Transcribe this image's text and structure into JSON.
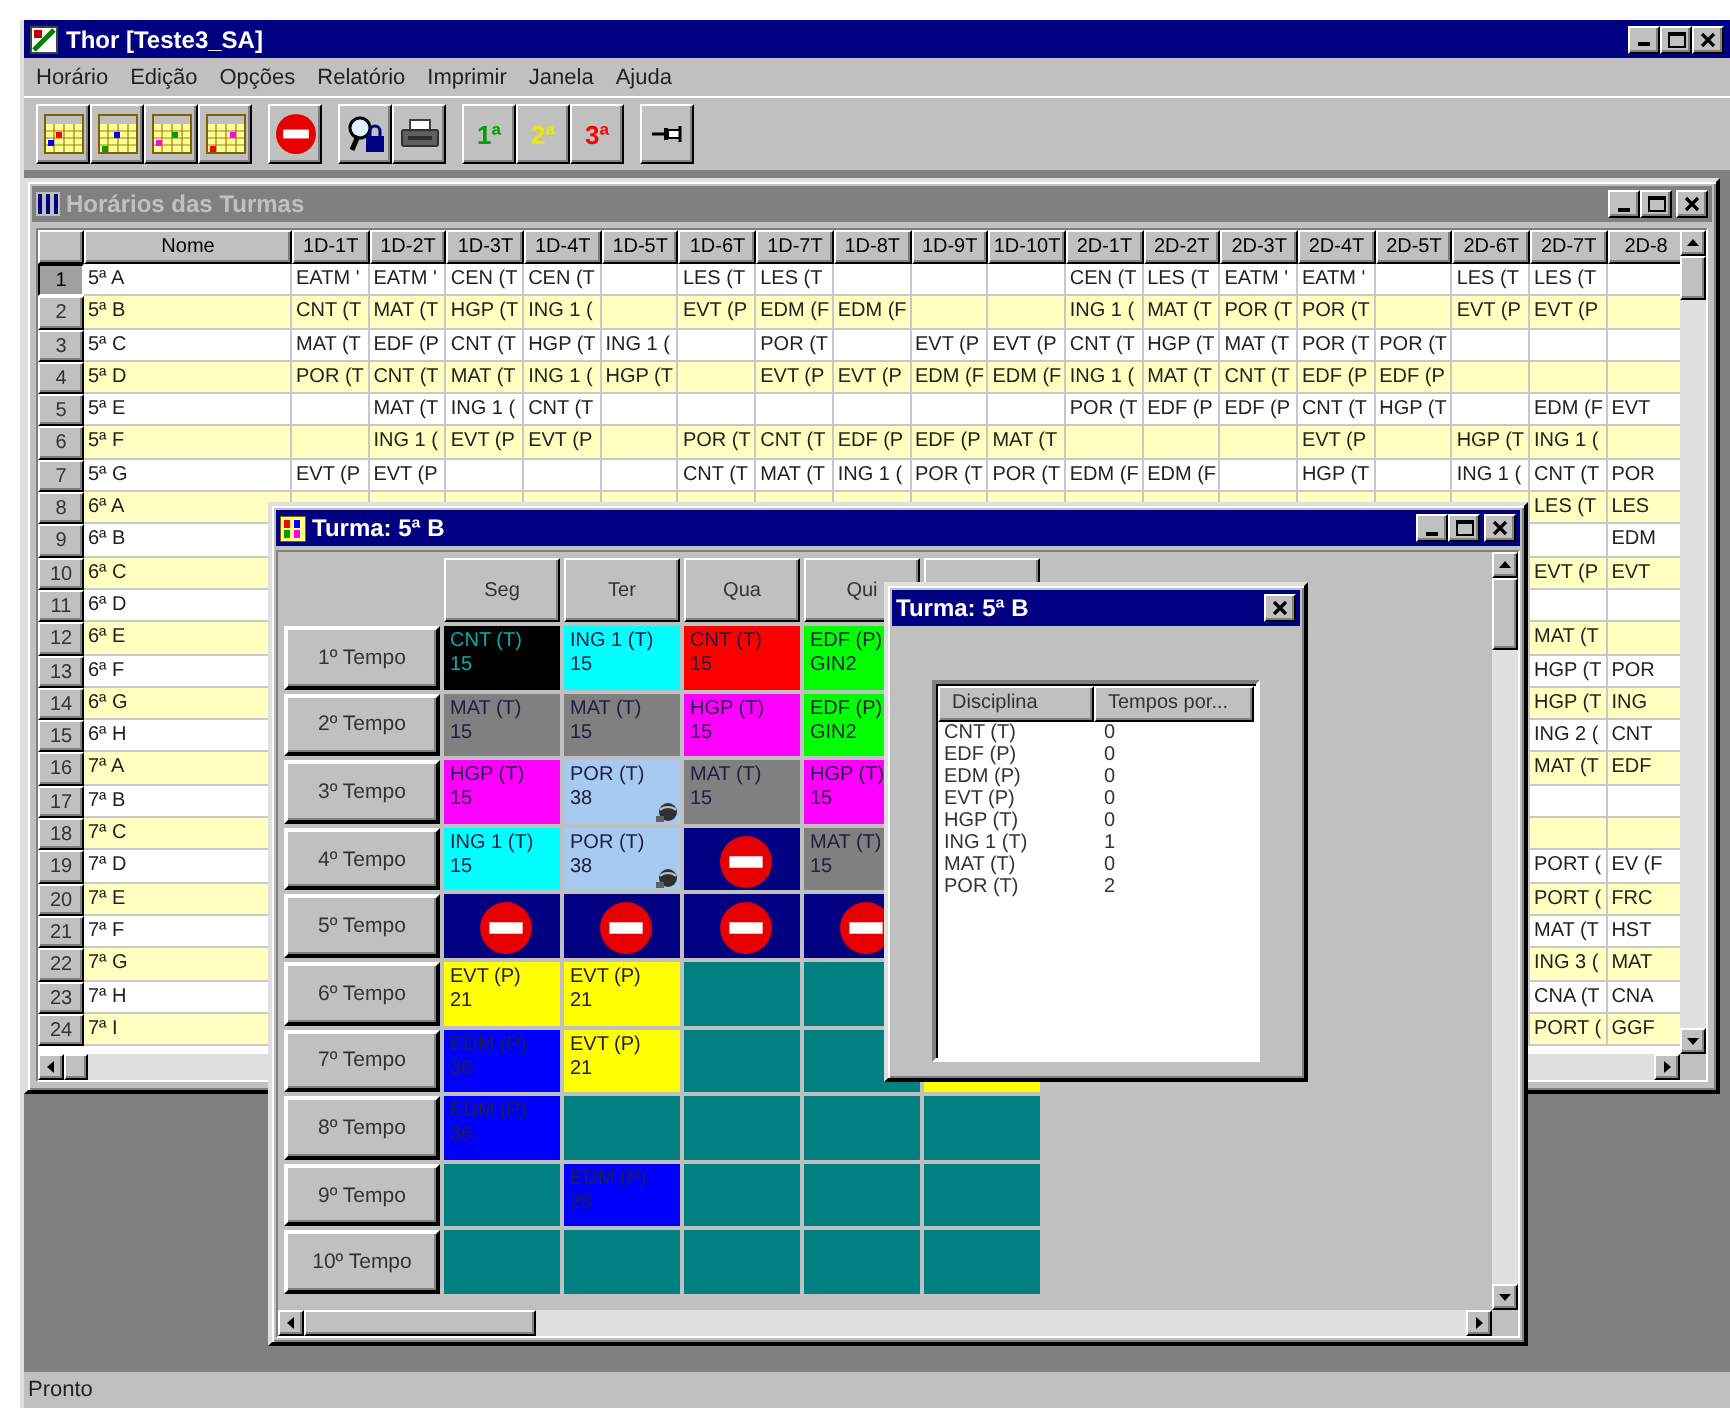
{
  "window": {
    "title": "Thor [Teste3_SA]"
  },
  "menu": [
    "Horário",
    "Edição",
    "Opções",
    "Relatório",
    "Imprimir",
    "Janela",
    "Ajuda"
  ],
  "toolbar": [
    [
      {
        "kind": "calendar"
      },
      {
        "kind": "calendar"
      },
      {
        "kind": "calendar"
      },
      {
        "kind": "calendar"
      }
    ],
    [
      {
        "kind": "stop"
      }
    ],
    [
      {
        "kind": "lock"
      },
      {
        "kind": "printer"
      }
    ],
    [
      {
        "kind": "label",
        "label": "1ª",
        "color": "#00a000"
      },
      {
        "kind": "label",
        "label": "2ª",
        "color": "#e8e800"
      },
      {
        "kind": "label",
        "label": "3ª",
        "color": "#ff0000"
      }
    ],
    [
      {
        "kind": "pin"
      }
    ]
  ],
  "schedule_window": {
    "title": "Horários das Turmas",
    "active": false,
    "columns": [
      "Nome",
      "1D-1T",
      "1D-2T",
      "1D-3T",
      "1D-4T",
      "1D-5T",
      "1D-6T",
      "1D-7T",
      "1D-8T",
      "1D-9T",
      "1D-10T",
      "2D-1T",
      "2D-2T",
      "2D-3T",
      "2D-4T",
      "2D-5T",
      "2D-6T",
      "2D-7T",
      "2D-8"
    ],
    "rows": [
      {
        "cells": [
          "5ª A",
          "EATM '",
          "EATM '",
          "CEN (T",
          "CEN (T",
          "",
          "LES (T",
          "LES (T",
          "",
          "",
          "",
          "CEN (T",
          "LES (T",
          "EATM '",
          "EATM '",
          "",
          "LES (T",
          "LES (T",
          ""
        ],
        "number": "1",
        "selected": true
      },
      {
        "cells": [
          "5ª B",
          "CNT (T",
          "MAT (T",
          "HGP (T",
          "ING 1 (",
          "",
          "EVT (P",
          "EDM (F",
          "EDM (F",
          "",
          "",
          "ING 1 (",
          "MAT (T",
          "POR (T",
          "POR (T",
          "",
          "EVT (P",
          "EVT (P",
          ""
        ],
        "number": "2",
        "selected": false
      },
      {
        "cells": [
          "5ª C",
          "MAT (T",
          "EDF (P",
          "CNT (T",
          "HGP (T",
          "ING 1 (",
          "",
          "POR (T",
          "",
          "EVT (P",
          "EVT (P",
          "CNT (T",
          "HGP (T",
          "MAT (T",
          "POR (T",
          "POR (T",
          "",
          "",
          ""
        ],
        "number": "3",
        "selected": false
      },
      {
        "cells": [
          "5ª D",
          "POR (T",
          "CNT (T",
          "MAT (T",
          "ING 1 (",
          "HGP (T",
          "",
          "EVT (P",
          "EVT (P",
          "EDM (F",
          "EDM (F",
          "ING 1 (",
          "MAT (T",
          "CNT (T",
          "EDF (P",
          "EDF (P",
          "",
          "",
          ""
        ],
        "number": "4",
        "selected": false
      },
      {
        "cells": [
          "5ª E",
          "",
          "MAT (T",
          "ING 1 (",
          "CNT (T",
          "",
          "",
          "",
          "",
          "",
          "",
          "POR (T",
          "EDF (P",
          "EDF (P",
          "CNT (T",
          "HGP (T",
          "",
          "EDM (F",
          "EVT"
        ],
        "number": "5",
        "selected": false
      },
      {
        "cells": [
          "5ª F",
          "",
          "ING 1 (",
          "EVT (P",
          "EVT (P",
          "",
          "POR (T",
          "CNT (T",
          "EDF (P",
          "EDF (P",
          "MAT (T",
          "",
          "",
          "",
          "EVT (P",
          "",
          "HGP (T",
          "ING 1 (",
          ""
        ],
        "number": "6",
        "selected": false
      },
      {
        "cells": [
          "5ª G",
          "EVT (P",
          "EVT (P",
          "",
          "",
          "",
          "CNT (T",
          "MAT (T",
          "ING 1 (",
          "POR (T",
          "POR (T",
          "EDM (F",
          "EDM (F",
          "",
          "HGP (T",
          "",
          "ING 1 (",
          "CNT (T",
          "POR"
        ],
        "number": "7",
        "selected": false
      },
      {
        "cells": [
          "6ª A",
          "",
          "",
          "",
          "",
          "",
          "",
          "",
          "",
          "",
          "",
          "",
          "",
          "",
          "",
          "",
          "",
          "LES (T",
          "LES"
        ],
        "number": "8",
        "selected": false
      },
      {
        "cells": [
          "6ª B",
          "",
          "",
          "",
          "",
          "",
          "",
          "",
          "",
          "",
          "",
          "",
          "",
          "",
          "",
          "",
          "",
          "",
          "EDM"
        ],
        "number": "9",
        "selected": false
      },
      {
        "cells": [
          "6ª C",
          "",
          "",
          "",
          "",
          "",
          "",
          "",
          "",
          "",
          "",
          "",
          "",
          "",
          "",
          "",
          "",
          "EVT (P",
          "EVT"
        ],
        "number": "10",
        "selected": false
      },
      {
        "cells": [
          "6ª D",
          "",
          "",
          "",
          "",
          "",
          "",
          "",
          "",
          "",
          "",
          "",
          "",
          "",
          "",
          "",
          "",
          "",
          ""
        ],
        "number": "11",
        "selected": false
      },
      {
        "cells": [
          "6ª E",
          "",
          "",
          "",
          "",
          "",
          "",
          "",
          "",
          "",
          "",
          "",
          "",
          "",
          "",
          "",
          "",
          "MAT (T",
          ""
        ],
        "number": "12",
        "selected": false
      },
      {
        "cells": [
          "6ª F",
          "",
          "",
          "",
          "",
          "",
          "",
          "",
          "",
          "",
          "",
          "",
          "",
          "",
          "",
          "",
          "",
          "HGP (T",
          "POR"
        ],
        "number": "13",
        "selected": false
      },
      {
        "cells": [
          "6ª G",
          "",
          "",
          "",
          "",
          "",
          "",
          "",
          "",
          "",
          "",
          "",
          "",
          "",
          "",
          "",
          "",
          "HGP (T",
          "ING"
        ],
        "number": "14",
        "selected": false
      },
      {
        "cells": [
          "6ª H",
          "",
          "",
          "",
          "",
          "",
          "",
          "",
          "",
          "",
          "",
          "",
          "",
          "",
          "",
          "",
          "",
          "ING 2 (",
          "CNT"
        ],
        "number": "15",
        "selected": false
      },
      {
        "cells": [
          "7ª A",
          "",
          "",
          "",
          "",
          "",
          "",
          "",
          "",
          "",
          "",
          "",
          "",
          "",
          "",
          "",
          "",
          "MAT (T",
          "EDF"
        ],
        "number": "16",
        "selected": false
      },
      {
        "cells": [
          "7ª B",
          "",
          "",
          "",
          "",
          "",
          "",
          "",
          "",
          "",
          "",
          "",
          "",
          "",
          "",
          "",
          "",
          "",
          ""
        ],
        "number": "17",
        "selected": false
      },
      {
        "cells": [
          "7ª C",
          "",
          "",
          "",
          "",
          "",
          "",
          "",
          "",
          "",
          "",
          "",
          "",
          "",
          "",
          "",
          "",
          "",
          ""
        ],
        "number": "18",
        "selected": false
      },
      {
        "cells": [
          "7ª D",
          "",
          "",
          "",
          "",
          "",
          "",
          "",
          "",
          "",
          "",
          "",
          "",
          "",
          "",
          "",
          "",
          "PORT (",
          "EV (F"
        ],
        "number": "19",
        "selected": false
      },
      {
        "cells": [
          "7ª E",
          "",
          "",
          "",
          "",
          "",
          "",
          "",
          "",
          "",
          "",
          "",
          "",
          "",
          "",
          "",
          "",
          "PORT (",
          "FRC"
        ],
        "number": "20",
        "selected": false
      },
      {
        "cells": [
          "7ª F",
          "",
          "",
          "",
          "",
          "",
          "",
          "",
          "",
          "",
          "",
          "",
          "",
          "",
          "",
          "",
          "",
          "MAT (T",
          "HST"
        ],
        "number": "21",
        "selected": false
      },
      {
        "cells": [
          "7ª G",
          "",
          "",
          "",
          "",
          "",
          "",
          "",
          "",
          "",
          "",
          "",
          "",
          "",
          "",
          "",
          "",
          "ING 3 (",
          "MAT"
        ],
        "number": "22",
        "selected": false
      },
      {
        "cells": [
          "7ª H",
          "",
          "",
          "",
          "",
          "",
          "",
          "",
          "",
          "",
          "",
          "",
          "",
          "",
          "",
          "",
          "",
          "CNA (T",
          "CNA"
        ],
        "number": "23",
        "selected": false
      },
      {
        "cells": [
          "7ª I",
          "",
          "",
          "",
          "",
          "",
          "",
          "",
          "",
          "",
          "",
          "",
          "",
          "",
          "",
          "",
          "",
          "PORT (",
          "GGF"
        ],
        "number": "24",
        "selected": false
      }
    ]
  },
  "turma_window": {
    "title": "Turma: 5ª B",
    "active": true,
    "days": [
      "Seg",
      "Ter",
      "Qua",
      "Qui"
    ],
    "periods": [
      {
        "label": "1º Tempo",
        "cells": [
          {
            "kind": "lesson",
            "subject": "CNT (T)",
            "detail": "15",
            "color": "#000000",
            "marked": false
          },
          {
            "kind": "lesson",
            "subject": "ING 1 (T)",
            "detail": "15",
            "color": "#00ffff",
            "marked": false
          },
          {
            "kind": "lesson",
            "subject": "CNT (T)",
            "detail": "15",
            "color": "#ff0000",
            "marked": false
          },
          {
            "kind": "lesson",
            "subject": "EDF (P)",
            "detail": "GIN2",
            "color": "#00ff00",
            "marked": false
          }
        ]
      },
      {
        "label": "2º Tempo",
        "cells": [
          {
            "kind": "lesson",
            "subject": "MAT (T)",
            "detail": "15",
            "color": "#808080",
            "marked": false
          },
          {
            "kind": "lesson",
            "subject": "MAT (T)",
            "detail": "15",
            "color": "#808080",
            "marked": false
          },
          {
            "kind": "lesson",
            "subject": "HGP (T)",
            "detail": "15",
            "color": "#ff00ff",
            "marked": false
          },
          {
            "kind": "lesson",
            "subject": "EDF (P)",
            "detail": "GIN2",
            "color": "#00ff00",
            "marked": false
          }
        ]
      },
      {
        "label": "3º Tempo",
        "cells": [
          {
            "kind": "lesson",
            "subject": "HGP (T)",
            "detail": "15",
            "color": "#ff00ff",
            "marked": false
          },
          {
            "kind": "lesson",
            "subject": "POR (T)",
            "detail": "38",
            "color": "#a6caf0",
            "marked": true
          },
          {
            "kind": "lesson",
            "subject": "MAT (T)",
            "detail": "15",
            "color": "#808080",
            "marked": false
          },
          {
            "kind": "lesson",
            "subject": "HGP (T)",
            "detail": "15",
            "color": "#ff00ff",
            "marked": false
          }
        ]
      },
      {
        "label": "4º Tempo",
        "cells": [
          {
            "kind": "lesson",
            "subject": "ING 1 (T)",
            "detail": "15",
            "color": "#00ffff",
            "marked": false
          },
          {
            "kind": "lesson",
            "subject": "POR (T)",
            "detail": "38",
            "color": "#a6caf0",
            "marked": true
          },
          {
            "kind": "blocked"
          },
          {
            "kind": "lesson",
            "subject": "MAT (T)",
            "detail": "15",
            "color": "#808080",
            "marked": false
          }
        ]
      },
      {
        "label": "5º Tempo",
        "cells": [
          {
            "kind": "blocked"
          },
          {
            "kind": "blocked"
          },
          {
            "kind": "blocked"
          },
          {
            "kind": "blocked"
          }
        ]
      },
      {
        "label": "6º Tempo",
        "cells": [
          {
            "kind": "lesson",
            "subject": "EVT (P)",
            "detail": "21",
            "color": "#ffff00",
            "marked": false
          },
          {
            "kind": "lesson",
            "subject": "EVT (P)",
            "detail": "21",
            "color": "#ffff00",
            "marked": false
          },
          {
            "kind": "empty"
          },
          {
            "kind": "empty"
          }
        ]
      },
      {
        "label": "7º Tempo",
        "cells": [
          {
            "kind": "lesson",
            "subject": "EDM (P)",
            "detail": "36",
            "color": "#0000ff",
            "marked": false
          },
          {
            "kind": "lesson",
            "subject": "EVT (P)",
            "detail": "21",
            "color": "#ffff00",
            "marked": false
          },
          {
            "kind": "empty"
          },
          {
            "kind": "empty"
          },
          {
            "kind": "lesson",
            "color": "#ffff00"
          }
        ]
      },
      {
        "label": "8º Tempo",
        "cells": [
          {
            "kind": "lesson",
            "subject": "EDM (P)",
            "detail": "36",
            "color": "#0000ff",
            "marked": false
          },
          {
            "kind": "empty"
          },
          {
            "kind": "empty"
          },
          {
            "kind": "empty"
          },
          {
            "kind": "empty"
          }
        ]
      },
      {
        "label": "9º Tempo",
        "cells": [
          {
            "kind": "empty"
          },
          {
            "kind": "lesson",
            "subject": "EDM (P)",
            "detail": "20",
            "color": "#0000ff",
            "marked": false
          },
          {
            "kind": "empty"
          },
          {
            "kind": "empty"
          },
          {
            "kind": "empty"
          }
        ]
      },
      {
        "label": "10º Tempo",
        "cells": [
          {
            "kind": "empty"
          },
          {
            "kind": "empty"
          },
          {
            "kind": "empty"
          },
          {
            "kind": "empty"
          },
          {
            "kind": "empty"
          }
        ]
      }
    ]
  },
  "summary_window": {
    "title": "Turma: 5ª B",
    "active": true,
    "columns": [
      "Disciplina",
      "Tempos por..."
    ],
    "rows": [
      {
        "subject": "CNT (T)",
        "count": "0"
      },
      {
        "subject": "EDF (P)",
        "count": "0"
      },
      {
        "subject": "EDM (P)",
        "count": "0"
      },
      {
        "subject": "EVT (P)",
        "count": "0"
      },
      {
        "subject": "HGP (T)",
        "count": "0"
      },
      {
        "subject": "ING 1 (T)",
        "count": "1"
      },
      {
        "subject": "MAT (T)",
        "count": "0"
      },
      {
        "subject": "POR (T)",
        "count": "2"
      }
    ]
  },
  "status_bar": "Pronto"
}
